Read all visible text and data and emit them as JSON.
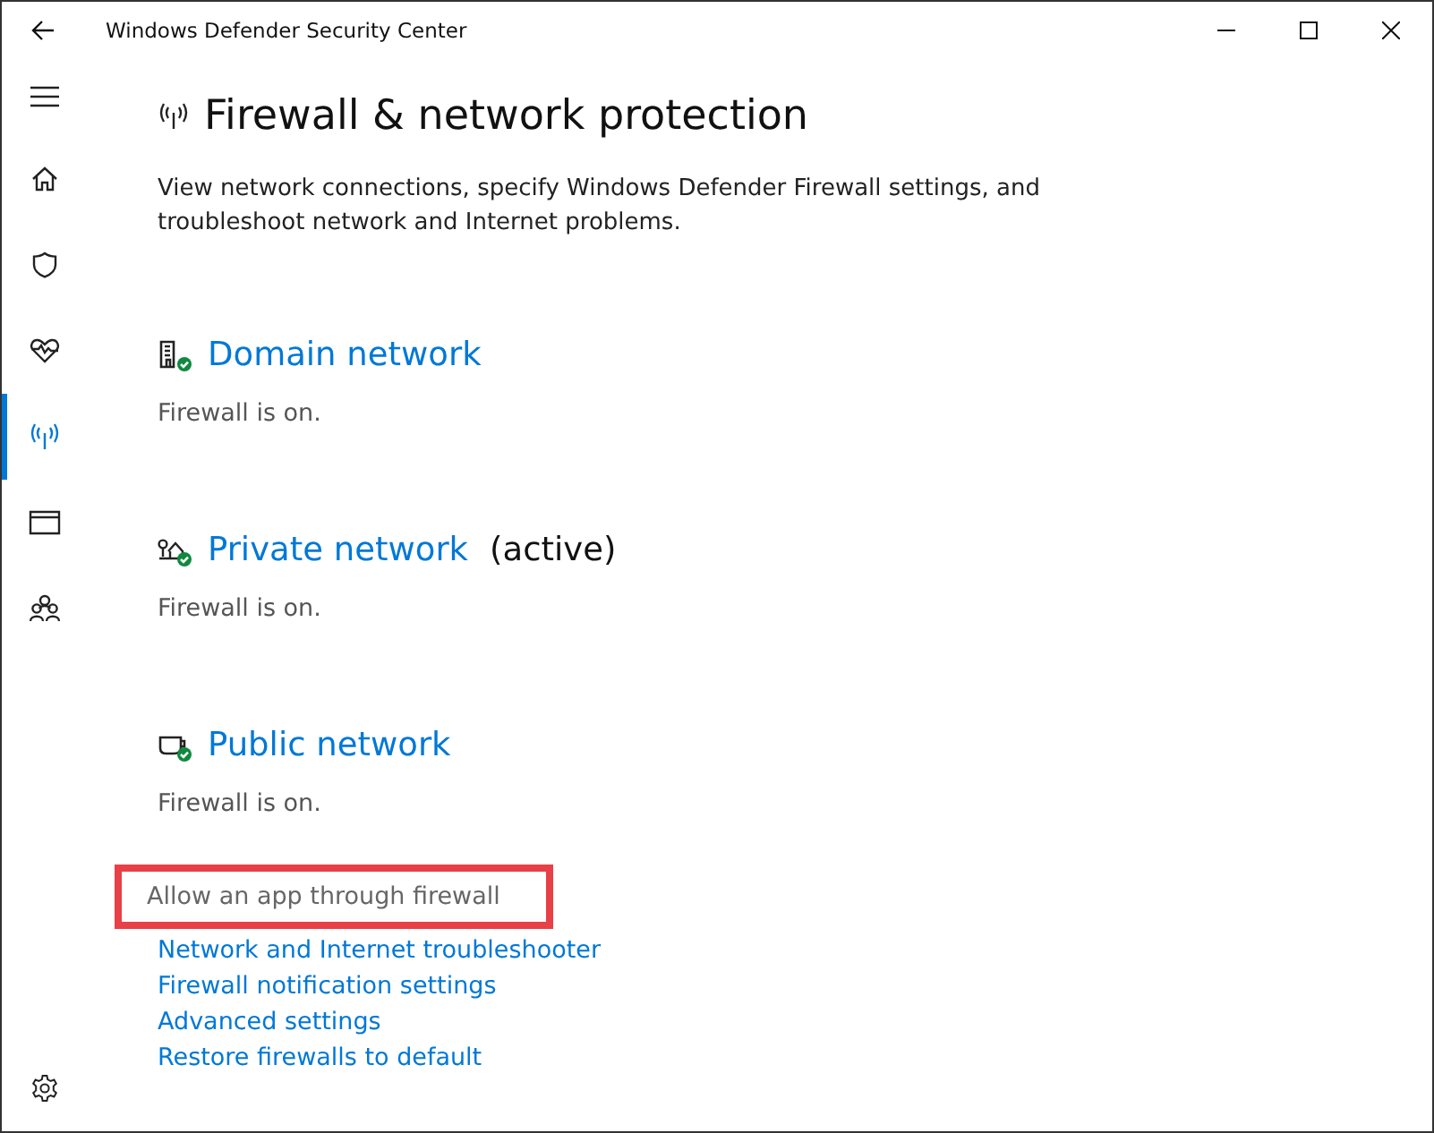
{
  "window": {
    "title": "Windows Defender Security Center"
  },
  "sidebar": {
    "items": [
      {
        "kind": "home",
        "selected": false
      },
      {
        "kind": "shield",
        "selected": false
      },
      {
        "kind": "heart",
        "selected": false
      },
      {
        "kind": "antenna",
        "selected": true
      },
      {
        "kind": "browser",
        "selected": false
      },
      {
        "kind": "family",
        "selected": false
      }
    ]
  },
  "page": {
    "title": "Firewall & network protection",
    "description": "View network connections, specify Windows Defender Firewall settings, and troubleshoot network and Internet problems."
  },
  "networks": [
    {
      "kind": "domain",
      "name": "Domain network",
      "status": "Firewall is on."
    },
    {
      "kind": "private",
      "name": "Private network",
      "active_label": "(active)",
      "status": "Firewall is on."
    },
    {
      "kind": "public",
      "name": "Public network",
      "status": "Firewall is on."
    }
  ],
  "links": [
    {
      "label": "Allow an app through firewall",
      "highlighted": true
    },
    {
      "label": "Network and Internet troubleshooter",
      "highlighted": false
    },
    {
      "label": "Firewall notification settings",
      "highlighted": false
    },
    {
      "label": "Advanced settings",
      "highlighted": false
    },
    {
      "label": "Restore firewalls to default",
      "highlighted": false
    }
  ]
}
